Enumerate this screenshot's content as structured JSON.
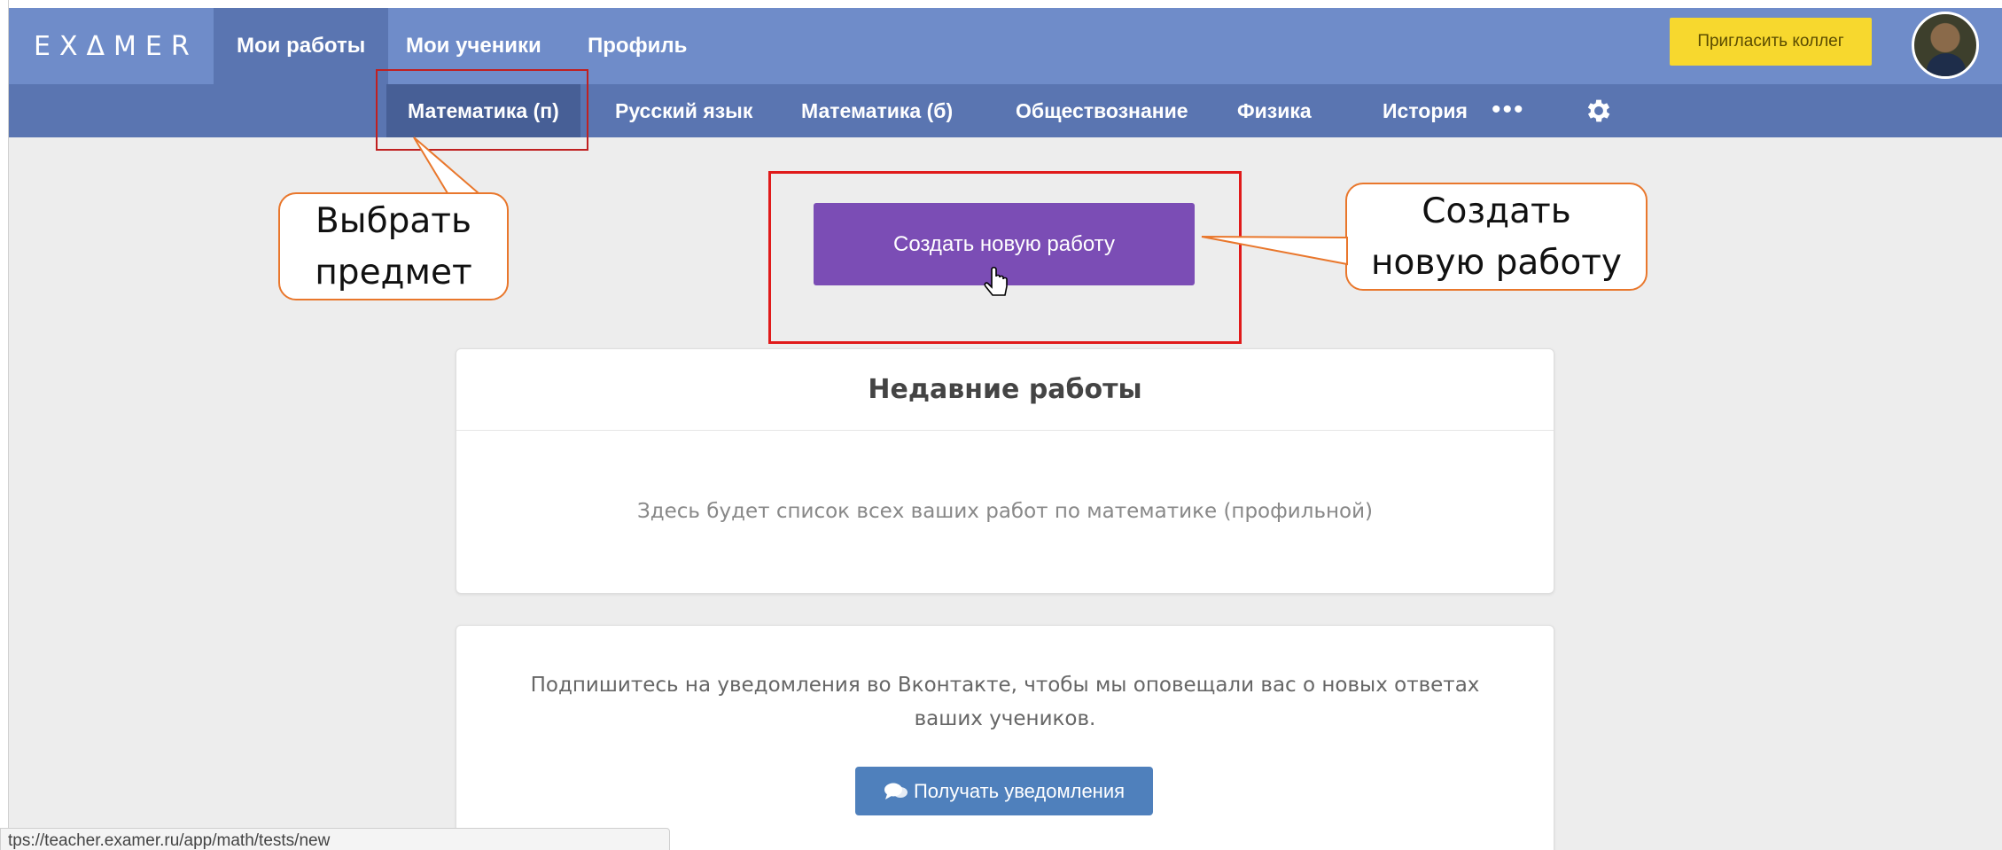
{
  "topnav": {
    "logo": "EXΔMER",
    "items": [
      "Мои работы",
      "Мои ученики",
      "Профиль"
    ],
    "invite_label": "Пригласить коллег"
  },
  "subjects": {
    "items": [
      "Математика (п)",
      "Русский язык",
      "Математика (б)",
      "Обществознание",
      "Физика",
      "История"
    ],
    "more": "•••"
  },
  "main": {
    "create_label": "Создать новую работу",
    "recent_title": "Недавние работы",
    "recent_empty": "Здесь будет список всех ваших работ по математике (профильной)",
    "subscribe_line1": "Подпишитесь на уведомления во Вконтакте, чтобы мы оповещали вас о новых ответах",
    "subscribe_line2": "ваших учеников.",
    "notify_label": "Получать уведомления"
  },
  "callouts": {
    "choose_line1": "Выбрать",
    "choose_line2": "предмет",
    "create_line1": "Создать",
    "create_line2": "новую работу"
  },
  "status_url": "tps://teacher.examer.ru/app/math/tests/new",
  "colors": {
    "topbar": "#6f8cc9",
    "subjbar": "#5a75b1",
    "create_button": "#7b4db5",
    "invite_button": "#f7d82e",
    "notify_button": "#4f80bc",
    "annotation_red": "#e01a1a",
    "callout_orange": "#e9772c"
  },
  "icons": [
    "gear-icon",
    "chat-icon",
    "hand-cursor-icon"
  ]
}
